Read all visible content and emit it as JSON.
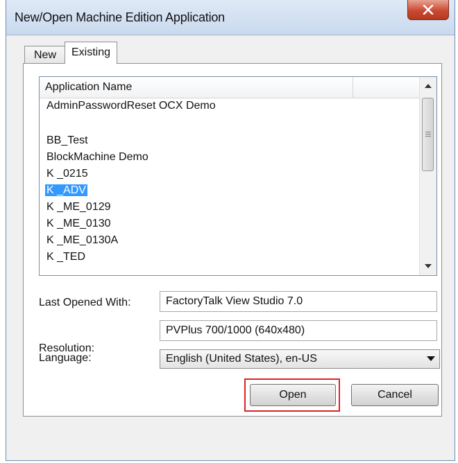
{
  "window": {
    "title": "New/Open Machine Edition Application"
  },
  "tabs": [
    {
      "label": "New",
      "active": false
    },
    {
      "label": "Existing",
      "active": true
    }
  ],
  "app_list": {
    "column_header": "Application Name",
    "items": [
      {
        "label": "AdminPasswordReset OCX Demo",
        "selected": false
      },
      {
        "label": "",
        "selected": false
      },
      {
        "label": "BB_Test",
        "selected": false
      },
      {
        "label": "BlockMachine Demo",
        "selected": false
      },
      {
        "label": "K _0215",
        "selected": false
      },
      {
        "label": "K _ADV",
        "selected": true
      },
      {
        "label": "K _ME_0129",
        "selected": false
      },
      {
        "label": "K _ME_0130",
        "selected": false
      },
      {
        "label": "K _ME_0130A",
        "selected": false
      },
      {
        "label": "K _TED",
        "selected": false
      }
    ]
  },
  "fields": {
    "last_opened_with": {
      "label": "Last Opened With:",
      "value": "FactoryTalk View Studio 7.0"
    },
    "resolution": {
      "label": "Resolution:",
      "value": "PVPlus 700/1000 (640x480)"
    },
    "language": {
      "label": "Language:",
      "value": "English (United States), en-US"
    }
  },
  "buttons": {
    "open": "Open",
    "cancel": "Cancel"
  },
  "colors": {
    "selection": "#3399ff",
    "highlight_outline": "#e02020",
    "close_button": "#c94a32"
  },
  "icons": [
    "close-icon",
    "scroll-up-icon",
    "scroll-down-icon",
    "scroll-grip-icon",
    "dropdown-arrow-icon"
  ]
}
